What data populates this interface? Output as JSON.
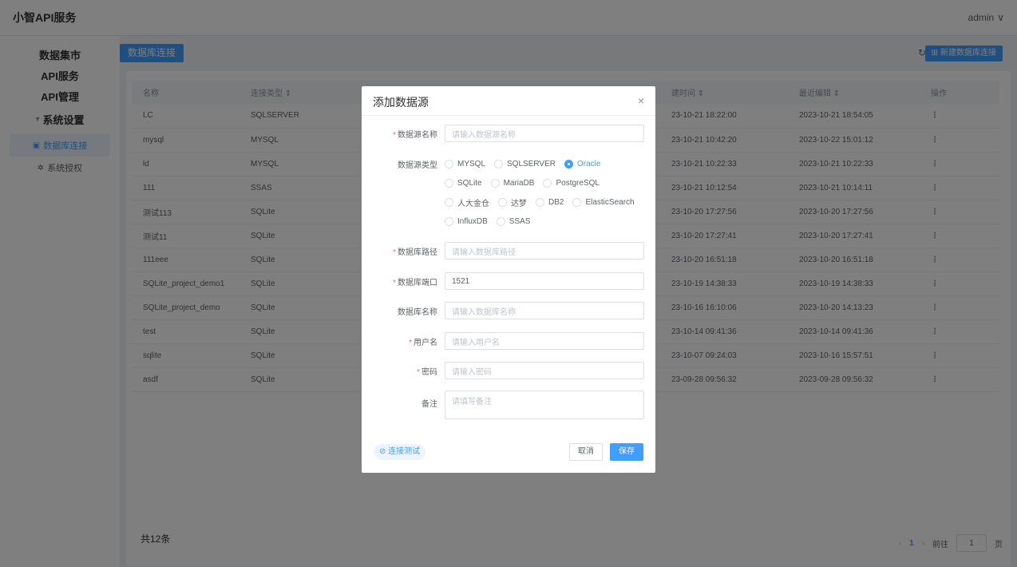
{
  "app_title": "小智API服务",
  "user": {
    "name": "admin",
    "caret": "∨"
  },
  "sidebar": {
    "items": [
      {
        "label": "数据集市"
      },
      {
        "label": "API服务"
      },
      {
        "label": "API管理"
      },
      {
        "label": "系统设置",
        "caret": "▾"
      }
    ],
    "sub_items": [
      {
        "label": "数据库连接",
        "icon": "▣"
      },
      {
        "label": "系统授权",
        "icon": "✲"
      }
    ]
  },
  "tab_label": "数据库连接",
  "toolbar": {
    "refresh_icon": "↻",
    "new_button": "新建数据库连接",
    "new_icon": "⊞"
  },
  "table": {
    "headers": [
      "名称",
      "连接类型 ⇕",
      "",
      "建时间 ⇕",
      "最近编辑 ⇕",
      "操作"
    ],
    "rows": [
      {
        "name": "LC",
        "type": "SQLSERVER",
        "created": "23-10-21 18:22:00",
        "edited": "2023-10-21 18:54:05"
      },
      {
        "name": "mysql",
        "type": "MYSQL",
        "created": "23-10-21 10:42:20",
        "edited": "2023-10-22 15:01:12"
      },
      {
        "name": "ld",
        "type": "MYSQL",
        "created": "23-10-21 10:22:33",
        "edited": "2023-10-21 10:22:33"
      },
      {
        "name": "111",
        "type": "SSAS",
        "created": "23-10-21 10:12:54",
        "edited": "2023-10-21 10:14:11"
      },
      {
        "name": "测试113",
        "type": "SQLite",
        "created": "23-10-20 17:27:56",
        "edited": "2023-10-20 17:27:56"
      },
      {
        "name": "测试11",
        "type": "SQLite",
        "created": "23-10-20 17:27:41",
        "edited": "2023-10-20 17:27:41"
      },
      {
        "name": "111eee",
        "type": "SQLite",
        "created": "23-10-20 16:51:18",
        "edited": "2023-10-20 16:51:18"
      },
      {
        "name": "SQLite_project_demo1",
        "type": "SQLite",
        "created": "23-10-19 14:38:33",
        "edited": "2023-10-19 14:38:33"
      },
      {
        "name": "SQLite_project_demo",
        "type": "SQLite",
        "created": "23-10-16 16:10:06",
        "edited": "2023-10-20 14:13:23"
      },
      {
        "name": "test",
        "type": "SQLite",
        "created": "23-10-14 09:41:36",
        "edited": "2023-10-14 09:41:36"
      },
      {
        "name": "sqlite",
        "type": "SQLite",
        "created": "23-10-07 09:24:03",
        "edited": "2023-10-16 15:57:51"
      },
      {
        "name": "asdf",
        "type": "SQLite",
        "created": "23-09-28 09:56:32",
        "edited": "2023-09-28 09:56:32"
      }
    ],
    "ops_glyph": "⋮"
  },
  "total": "共12条",
  "pager": {
    "prev": "‹",
    "current": "1",
    "next": "›",
    "goto_label": "前往",
    "goto_value": "1",
    "unit": "页"
  },
  "dialog": {
    "title": "添加数据源",
    "close": "×",
    "fields": {
      "name": {
        "label": "数据源名称",
        "placeholder": "请输入数据源名称",
        "required": "*"
      },
      "type": {
        "label": "数据源类型"
      },
      "path": {
        "label": "数据库路径",
        "placeholder": "请输入数据库路径",
        "required": "*"
      },
      "port": {
        "label": "数据库端口",
        "value": "1521",
        "required": "*"
      },
      "dbname": {
        "label": "数据库名称",
        "placeholder": "请输入数据库名称"
      },
      "username": {
        "label": "用户名",
        "placeholder": "请输入用户名",
        "required": "*"
      },
      "password": {
        "label": "密码",
        "placeholder": "请输入密码",
        "required": "*"
      },
      "remark": {
        "label": "备注",
        "placeholder": "请填写备注"
      }
    },
    "radio_rows": [
      [
        "MYSQL",
        "SQLSERVER",
        "Oracle"
      ],
      [
        "SQLite",
        "MariaDB",
        "PostgreSQL"
      ],
      [
        "人大金仓",
        "达梦",
        "DB2",
        "ElasticSearch"
      ],
      [
        "InfluxDB",
        "SSAS"
      ]
    ],
    "selected_type": "Oracle",
    "test_button": "连接测试",
    "test_icon": "⊘",
    "cancel_button": "取消",
    "save_button": "保存"
  }
}
